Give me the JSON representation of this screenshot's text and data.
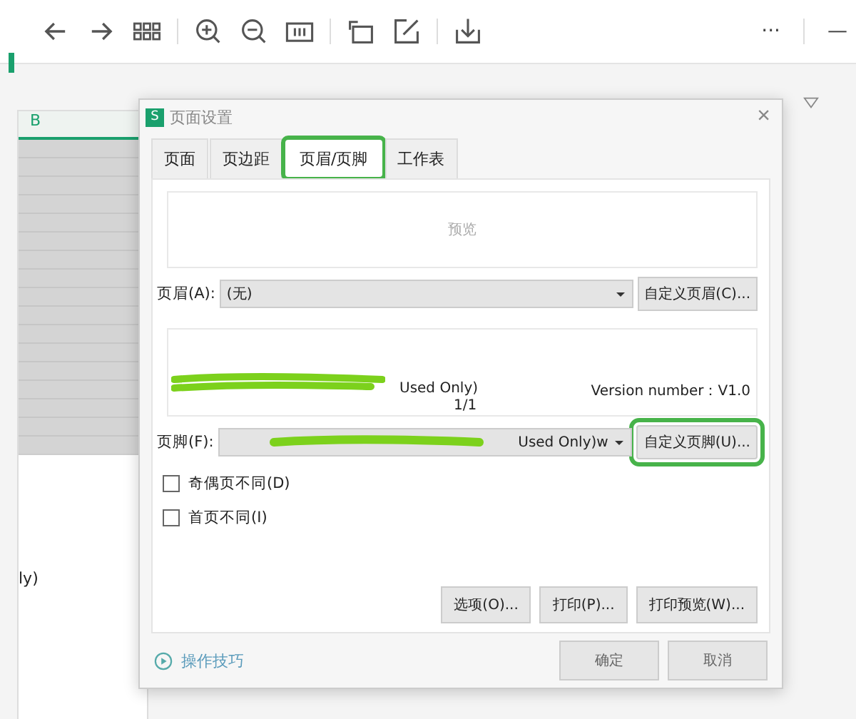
{
  "toolbar": {
    "more": "···",
    "minimize": "—"
  },
  "sheet": {
    "column_header": "B",
    "cell_text": "ly)"
  },
  "dialog": {
    "title": "页面设置",
    "app_badge": "S",
    "close": "×",
    "tabs": [
      {
        "label": "页面",
        "selected": false
      },
      {
        "label": "页边距",
        "selected": false
      },
      {
        "label": "页眉/页脚",
        "selected": true
      },
      {
        "label": "工作表",
        "selected": false
      }
    ],
    "header_preview": {
      "text": "预览"
    },
    "header": {
      "label": "页眉(A):",
      "value": "(无)",
      "button": "自定义页眉(C)...",
      "highlighted": false
    },
    "footer_preview": {
      "left": "Used Only)",
      "center": "1/1",
      "right": "Version number：V1.0"
    },
    "footer": {
      "label": "页脚(F):",
      "value": "Used Only)w",
      "button": "自定义页脚(U)...",
      "highlighted": true
    },
    "checkboxes": [
      {
        "label": "奇偶页不同(D)",
        "checked": false
      },
      {
        "label": "首页不同(I)",
        "checked": false
      }
    ],
    "buttons": [
      "选项(O)...",
      "打印(P)...",
      "打印预览(W)..."
    ],
    "tips_link": "操作技巧",
    "footer_buttons": [
      "确定",
      "取消"
    ]
  }
}
